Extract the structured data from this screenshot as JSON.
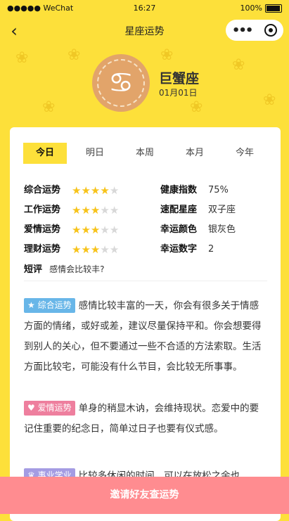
{
  "status_bar": {
    "carrier": "●●●●● WeChat",
    "time": "16:27",
    "battery": "100%"
  },
  "nav": {
    "title": "星座运势"
  },
  "sign": {
    "symbol": "♋",
    "name": "巨蟹座",
    "date": "01月01日"
  },
  "tabs": [
    {
      "label": "今日",
      "active": true
    },
    {
      "label": "明日",
      "active": false
    },
    {
      "label": "本周",
      "active": false
    },
    {
      "label": "本月",
      "active": false
    },
    {
      "label": "今年",
      "active": false
    }
  ],
  "ratings": [
    {
      "label": "综合运势",
      "stars": 4,
      "max": 5
    },
    {
      "label": "工作运势",
      "stars": 3,
      "max": 5
    },
    {
      "label": "爱情运势",
      "stars": 3,
      "max": 5
    },
    {
      "label": "理财运势",
      "stars": 3,
      "max": 5
    }
  ],
  "info": [
    {
      "label": "健康指数",
      "value": "75%"
    },
    {
      "label": "速配星座",
      "value": "双子座"
    },
    {
      "label": "幸运颜色",
      "value": "银灰色"
    },
    {
      "label": "幸运数字",
      "value": "2"
    }
  ],
  "short_comment": {
    "label": "短评",
    "value": "感情会比较丰?"
  },
  "sections": [
    {
      "badge": "综合运势",
      "badge_icon": "★",
      "color": "blue",
      "text": "感情比较丰富的一天，你会有很多关于情感方面的情绪，或好或差，建议尽量保持平和。你会想要得到别人的关心，但不要通过一些不合适的方法索取。生活方面比较宅，可能没有什么节目，会比较无所事事。"
    },
    {
      "badge": "爱情运势",
      "badge_icon": "♥",
      "color": "pink",
      "text": "单身的稍显木讷，会维持现状。恋爱中的要记住重要的纪念日，简单过日子也要有仪式感。"
    },
    {
      "badge": "事业学业",
      "badge_icon": "♛",
      "color": "purple",
      "text": "比较多休闲的时间，可以在放松之余也"
    }
  ],
  "invite_button": "邀请好友查运势"
}
